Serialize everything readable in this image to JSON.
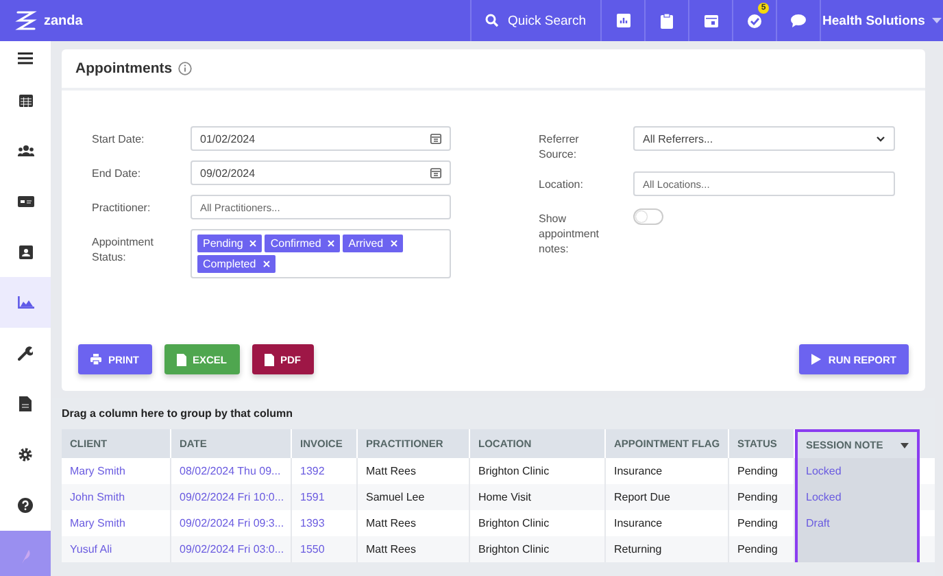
{
  "topbar": {
    "brand": "zanda",
    "search": "Quick Search",
    "icons": [
      {
        "kind": "report"
      },
      {
        "kind": "clipboard"
      },
      {
        "kind": "calendar"
      },
      {
        "kind": "tasks",
        "badge": "5"
      },
      {
        "kind": "chat"
      }
    ],
    "account": "Health Solutions"
  },
  "sidebar": {
    "items": [
      {
        "kind": "menu",
        "selected": false
      },
      {
        "kind": "calendar",
        "selected": false
      },
      {
        "kind": "users",
        "selected": false
      },
      {
        "kind": "card",
        "selected": false
      },
      {
        "kind": "image",
        "selected": false
      },
      {
        "kind": "chart",
        "selected": true
      },
      {
        "kind": "wrench",
        "selected": false
      },
      {
        "kind": "file",
        "selected": false
      },
      {
        "kind": "gear",
        "selected": false
      },
      {
        "kind": "help",
        "selected": false
      },
      {
        "kind": "brand",
        "selected": false
      }
    ]
  },
  "card": {
    "title": "Appointments",
    "left_fields": [
      {
        "label": "Start Date:",
        "kind": "date",
        "value": "01/02/2024"
      },
      {
        "label": "End Date:",
        "kind": "date",
        "value": "09/02/2024"
      },
      {
        "label": "Practitioner:",
        "kind": "text",
        "placeholder": "All Practitioners..."
      },
      {
        "label": "Appointment Status:",
        "kind": "tags",
        "tags": [
          "Pending",
          "Confirmed",
          "Arrived",
          "Completed"
        ]
      }
    ],
    "right_fields": [
      {
        "label": "Referrer Source:",
        "kind": "select",
        "value": "All Referrers..."
      },
      {
        "label": "Location:",
        "kind": "text",
        "placeholder": "All Locations..."
      },
      {
        "label": "Show appointment notes:",
        "kind": "toggle",
        "on": false
      }
    ],
    "buttons": [
      {
        "label": "PRINT",
        "kind": "print"
      },
      {
        "label": "EXCEL",
        "kind": "excel"
      },
      {
        "label": "PDF",
        "kind": "pdf"
      },
      {
        "label": "RUN REPORT",
        "kind": "run"
      }
    ]
  },
  "grid": {
    "group_hint": "Drag a column here to group by that column",
    "columns": [
      {
        "label": "CLIENT",
        "kind": "link",
        "selected": false
      },
      {
        "label": "DATE",
        "kind": "link",
        "selected": false
      },
      {
        "label": "INVOICE",
        "kind": "link",
        "selected": false
      },
      {
        "label": "PRACTITIONER",
        "kind": "text",
        "selected": false
      },
      {
        "label": "LOCATION",
        "kind": "text",
        "selected": false
      },
      {
        "label": "APPOINTMENT FLAG",
        "kind": "text",
        "selected": false
      },
      {
        "label": "STATUS",
        "kind": "text",
        "selected": false
      },
      {
        "label": "SESSION NOTE",
        "kind": "link",
        "selected": true
      }
    ],
    "rows": [
      [
        "Mary Smith",
        "08/02/2024 Thu 09...",
        "1392",
        "Matt Rees",
        "Brighton Clinic",
        "Insurance",
        "Pending",
        "Locked"
      ],
      [
        "John Smith",
        "09/02/2024 Fri 10:0...",
        "1591",
        "Samuel Lee",
        "Home Visit",
        "Report Due",
        "Pending",
        "Locked"
      ],
      [
        "Mary Smith",
        "09/02/2024 Fri 09:3...",
        "1393",
        "Matt Rees",
        "Brighton Clinic",
        "Insurance",
        "Pending",
        "Draft"
      ],
      [
        "Yusuf Ali",
        "09/02/2024 Fri 03:0...",
        "1550",
        "Matt Rees",
        "Brighton Clinic",
        "Returning",
        "Pending",
        ""
      ]
    ]
  }
}
